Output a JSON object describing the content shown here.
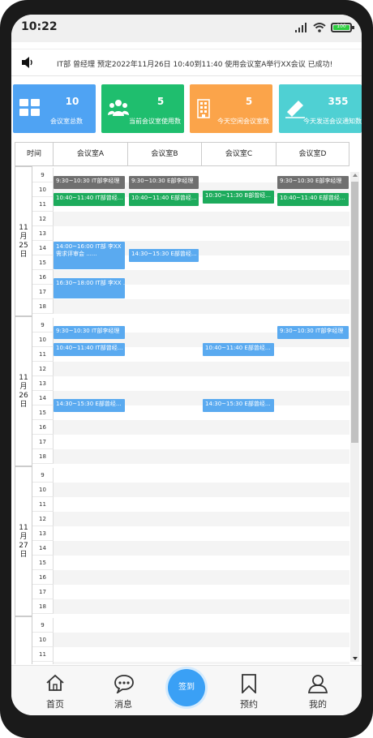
{
  "status_bar": {
    "time": "10:22",
    "battery": "100"
  },
  "notice": {
    "icon": "speaker-icon",
    "text": "IT部 曾经理 预定2022年11月26日 10:40到11:40 使用会议室A举行XX会议 已成功!"
  },
  "stats": [
    {
      "value": "10",
      "label": "会议室总数",
      "color": "#4fa3f3",
      "icon": "grid-icon"
    },
    {
      "value": "5",
      "label": "当前会议室使用数",
      "color": "#1fbe6e",
      "icon": "people-icon"
    },
    {
      "value": "5",
      "label": "今天空闲会议室数",
      "color": "#fba44a",
      "icon": "building-icon"
    },
    {
      "value": "355",
      "label": "今天发送会议通知数",
      "color": "#4fd0d3",
      "icon": "pencil-icon"
    }
  ],
  "grid": {
    "time_header": "时间",
    "rooms": [
      "会议室A",
      "会议室B",
      "会议室C",
      "会议室D"
    ],
    "hours": [
      "9",
      "10",
      "11",
      "12",
      "13",
      "14",
      "15",
      "16",
      "17",
      "18"
    ],
    "days": [
      {
        "lines": [
          "11",
          "月",
          "25",
          "日"
        ],
        "events": [
          {
            "room": 0,
            "start": 9.5,
            "end": 10.5,
            "text": "9:30~10:30  IT部李经理",
            "color": "gray"
          },
          {
            "room": 0,
            "start": 10.67,
            "end": 11.67,
            "text": "10:40~11:40  IT部曾经...",
            "color": "green"
          },
          {
            "room": 0,
            "start": 14,
            "end": 16,
            "text": "14:00~16:00  IT部 李XX 需求评审会 ......",
            "color": "blue"
          },
          {
            "room": 0,
            "start": 16.5,
            "end": 18,
            "text": "16:30~18:00  IT部 李XX ......",
            "color": "blue"
          },
          {
            "room": 1,
            "start": 9.5,
            "end": 10.5,
            "text": "9:30~10:30  E部李经理",
            "color": "gray"
          },
          {
            "room": 1,
            "start": 10.67,
            "end": 11.67,
            "text": "10:40~11:40  E部曾经...",
            "color": "green"
          },
          {
            "room": 1,
            "start": 14.5,
            "end": 15.5,
            "text": "14:30~15:30  E部曾经...",
            "color": "blue"
          },
          {
            "room": 2,
            "start": 10.5,
            "end": 11.5,
            "text": "10:30~11:30  B部曾经...",
            "color": "green"
          },
          {
            "room": 3,
            "start": 9.5,
            "end": 10.5,
            "text": "9:30~10:30  E部李经理",
            "color": "gray"
          },
          {
            "room": 3,
            "start": 10.67,
            "end": 11.67,
            "text": "10:40~11:40  E部曾经...",
            "color": "green"
          }
        ]
      },
      {
        "lines": [
          "11",
          "月",
          "26",
          "日"
        ],
        "events": [
          {
            "room": 0,
            "start": 9.5,
            "end": 10.5,
            "text": "9:30~10:30  IT部李经理",
            "color": "blue"
          },
          {
            "room": 0,
            "start": 10.67,
            "end": 11.67,
            "text": "10:40~11:40  IT部曾经...",
            "color": "blue"
          },
          {
            "room": 0,
            "start": 14.5,
            "end": 15.5,
            "text": "14:30~15:30  E部曾经...",
            "color": "blue"
          },
          {
            "room": 2,
            "start": 10.67,
            "end": 11.67,
            "text": "10:40~11:40  E部曾经...",
            "color": "blue"
          },
          {
            "room": 2,
            "start": 14.5,
            "end": 15.5,
            "text": "14:30~15:30  E部曾经...",
            "color": "blue"
          },
          {
            "room": 3,
            "start": 9.5,
            "end": 10.5,
            "text": "9:30~10:30  IT部李经理",
            "color": "blue"
          }
        ]
      },
      {
        "lines": [
          "11",
          "月",
          "27",
          "日"
        ],
        "events": []
      },
      {
        "lines": [],
        "events": []
      }
    ]
  },
  "tabs": [
    {
      "label": "首页",
      "icon": "home-icon"
    },
    {
      "label": "消息",
      "icon": "message-icon"
    },
    {
      "label": "签到",
      "icon": "signin-button"
    },
    {
      "label": "预约",
      "icon": "bookmark-icon"
    },
    {
      "label": "我的",
      "icon": "user-icon"
    }
  ]
}
